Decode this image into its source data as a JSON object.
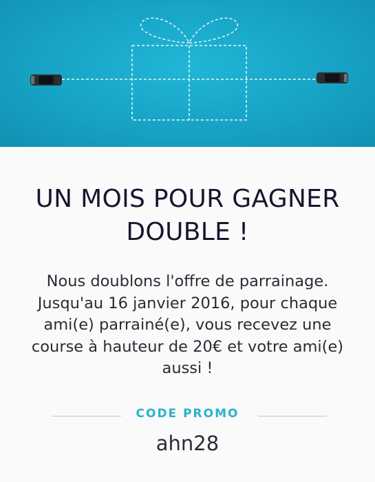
{
  "hero": {
    "illustration": "gift-box-with-cars",
    "background_color": "#1aa8c9"
  },
  "headline": "UN MOIS POUR GAGNER DOUBLE !",
  "description": "Nous doublons l'offre de parrainage. Jusqu'au 16 janvier 2016, pour chaque ami(e) parrainé(e), vous recevez une course à hauteur de 20€ et votre ami(e) aussi !",
  "promo": {
    "label": "CODE PROMO",
    "code": "ahn28",
    "accent_color": "#29b2cf"
  }
}
